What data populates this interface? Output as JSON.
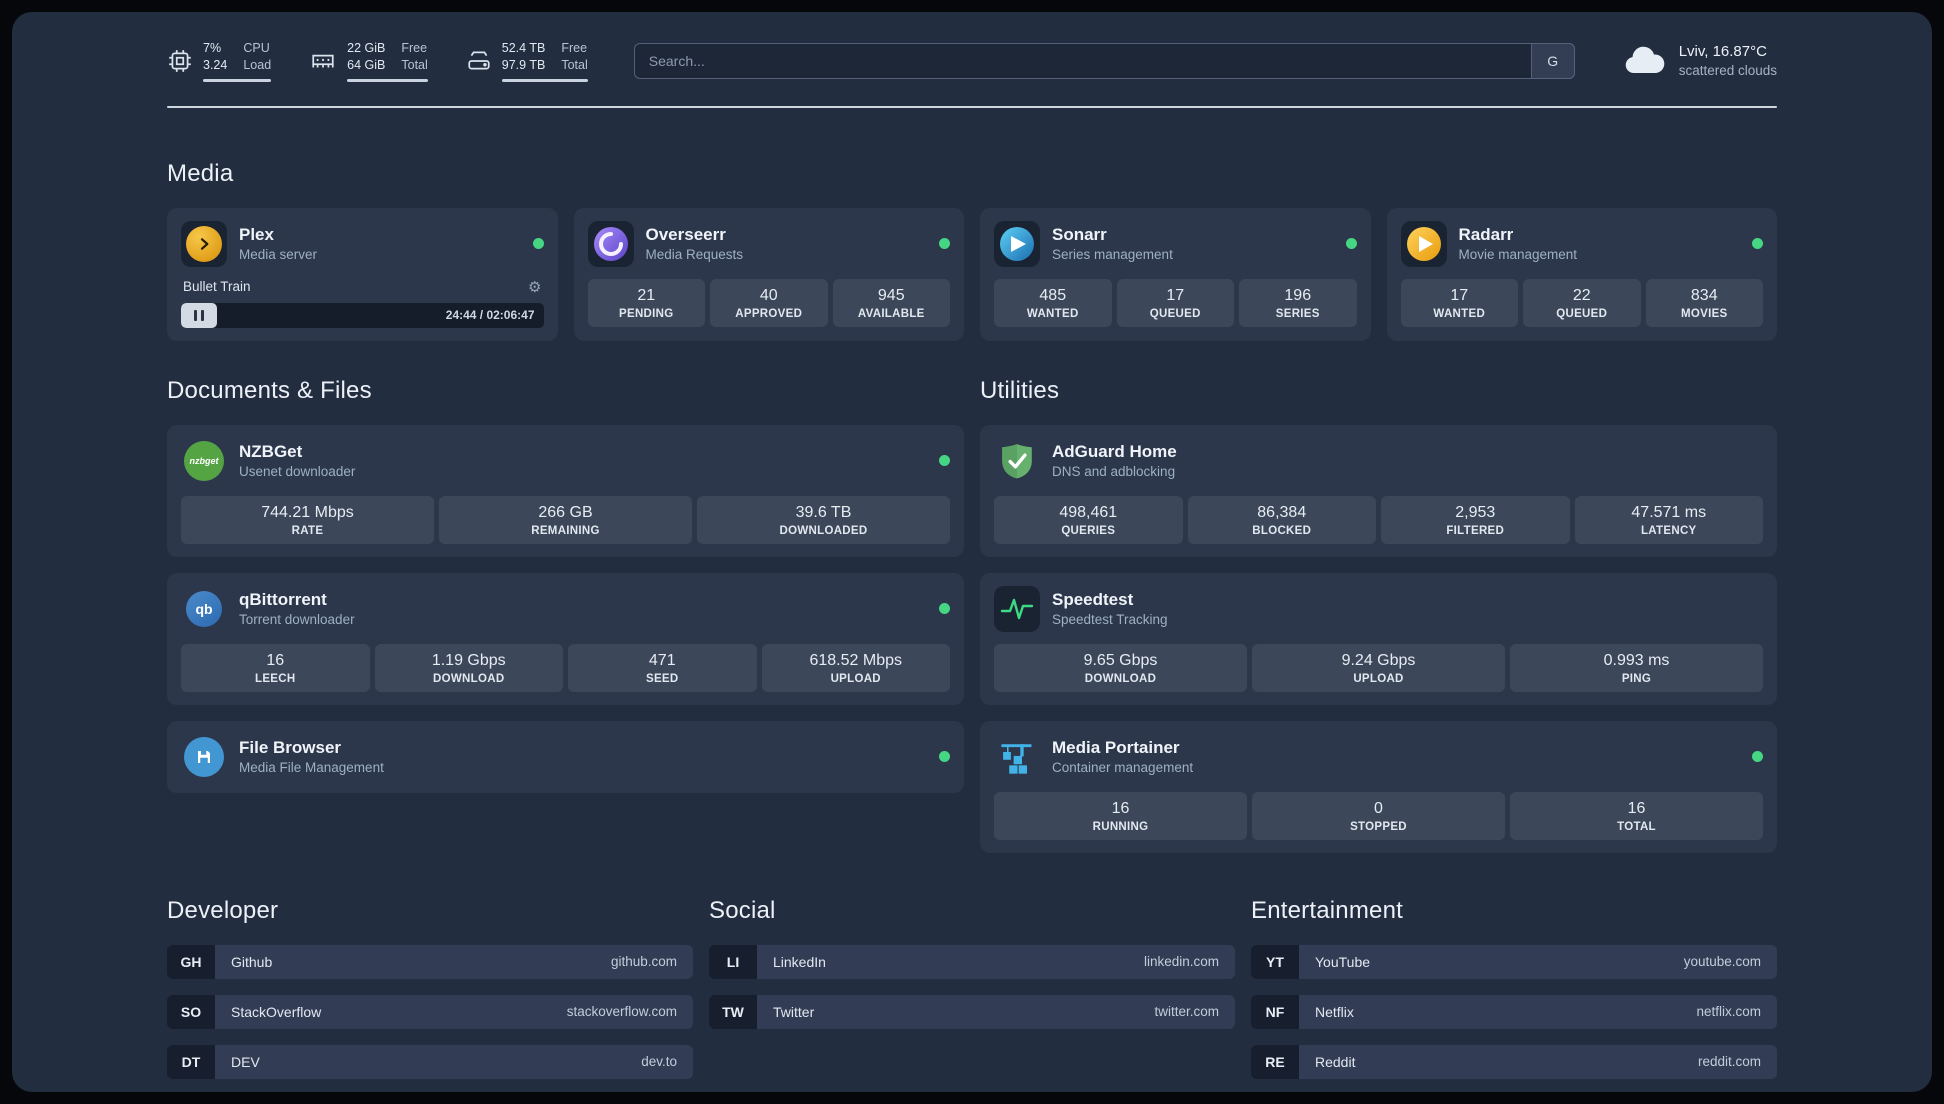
{
  "colors": {
    "status_online": "#46d583",
    "background": "#222d40",
    "card": "#2c374c",
    "tile": "#3c4759",
    "accent_plex": "#e5a00d",
    "accent_overseerr": "#7a5af8",
    "accent_sonarr": "#35c5f4",
    "accent_radarr": "#f5b52e",
    "accent_nzbget": "#55a444",
    "accent_qbittorrent": "#3577c0",
    "accent_filebrowser": "#4296d2",
    "accent_adguard": "#67b16e",
    "accent_speedtest": "#3ddc84",
    "accent_portainer": "#41b3e8"
  },
  "topbar": {
    "resources": [
      {
        "icon": "cpu-icon",
        "value_top": "7%",
        "value_bottom": "3.24",
        "label_top": "CPU",
        "label_bottom": "Load"
      },
      {
        "icon": "ram-icon",
        "value_top": "22 GiB",
        "value_bottom": "64 GiB",
        "label_top": "Free",
        "label_bottom": "Total"
      },
      {
        "icon": "disk-icon",
        "value_top": "52.4 TB",
        "value_bottom": "97.9 TB",
        "label_top": "Free",
        "label_bottom": "Total"
      }
    ],
    "search": {
      "placeholder": "Search...",
      "value": "",
      "button_label": "G"
    },
    "weather": {
      "location": "Lviv, 16.87°C",
      "condition": "scattered clouds"
    }
  },
  "icons": {
    "gear": "⚙",
    "nzbget_logo_text": "nzbget",
    "qbittorrent_logo_text": "qb"
  },
  "sections": {
    "media": {
      "title": "Media",
      "plex": {
        "name": "Plex",
        "desc": "Media server",
        "status": "online",
        "now_playing": "Bullet Train",
        "time": "24:44 / 02:06:47"
      },
      "overseerr": {
        "name": "Overseerr",
        "desc": "Media Requests",
        "status": "online",
        "stats": [
          {
            "value": "21",
            "label": "PENDING"
          },
          {
            "value": "40",
            "label": "APPROVED"
          },
          {
            "value": "945",
            "label": "AVAILABLE"
          }
        ]
      },
      "sonarr": {
        "name": "Sonarr",
        "desc": "Series management",
        "status": "online",
        "stats": [
          {
            "value": "485",
            "label": "WANTED"
          },
          {
            "value": "17",
            "label": "QUEUED"
          },
          {
            "value": "196",
            "label": "SERIES"
          }
        ]
      },
      "radarr": {
        "name": "Radarr",
        "desc": "Movie management",
        "status": "online",
        "stats": [
          {
            "value": "17",
            "label": "WANTED"
          },
          {
            "value": "22",
            "label": "QUEUED"
          },
          {
            "value": "834",
            "label": "MOVIES"
          }
        ]
      }
    },
    "documents": {
      "title": "Documents & Files",
      "nzbget": {
        "name": "NZBGet",
        "desc": "Usenet downloader",
        "status": "online",
        "stats": [
          {
            "value": "744.21 Mbps",
            "label": "RATE"
          },
          {
            "value": "266 GB",
            "label": "REMAINING"
          },
          {
            "value": "39.6 TB",
            "label": "DOWNLOADED"
          }
        ]
      },
      "qbittorrent": {
        "name": "qBittorrent",
        "desc": "Torrent downloader",
        "status": "online",
        "stats": [
          {
            "value": "16",
            "label": "LEECH"
          },
          {
            "value": "1.19 Gbps",
            "label": "DOWNLOAD"
          },
          {
            "value": "471",
            "label": "SEED"
          },
          {
            "value": "618.52 Mbps",
            "label": "UPLOAD"
          }
        ]
      },
      "filebrowser": {
        "name": "File Browser",
        "desc": "Media File Management",
        "status": "online"
      }
    },
    "utilities": {
      "title": "Utilities",
      "adguard": {
        "name": "AdGuard Home",
        "desc": "DNS and adblocking",
        "stats": [
          {
            "value": "498,461",
            "label": "QUERIES"
          },
          {
            "value": "86,384",
            "label": "BLOCKED"
          },
          {
            "value": "2,953",
            "label": "FILTERED"
          },
          {
            "value": "47.571 ms",
            "label": "LATENCY"
          }
        ]
      },
      "speedtest": {
        "name": "Speedtest",
        "desc": "Speedtest Tracking",
        "stats": [
          {
            "value": "9.65 Gbps",
            "label": "DOWNLOAD"
          },
          {
            "value": "9.24 Gbps",
            "label": "UPLOAD"
          },
          {
            "value": "0.993 ms",
            "label": "PING"
          }
        ]
      },
      "portainer": {
        "name": "Media Portainer",
        "desc": "Container management",
        "status": "online",
        "stats": [
          {
            "value": "16",
            "label": "RUNNING"
          },
          {
            "value": "0",
            "label": "STOPPED"
          },
          {
            "value": "16",
            "label": "TOTAL"
          }
        ]
      }
    }
  },
  "bookmarks": {
    "developer": {
      "title": "Developer",
      "items": [
        {
          "abbr": "GH",
          "name": "Github",
          "domain": "github.com"
        },
        {
          "abbr": "SO",
          "name": "StackOverflow",
          "domain": "stackoverflow.com"
        },
        {
          "abbr": "DT",
          "name": "DEV",
          "domain": "dev.to"
        }
      ]
    },
    "social": {
      "title": "Social",
      "items": [
        {
          "abbr": "LI",
          "name": "LinkedIn",
          "domain": "linkedin.com"
        },
        {
          "abbr": "TW",
          "name": "Twitter",
          "domain": "twitter.com"
        }
      ]
    },
    "entertainment": {
      "title": "Entertainment",
      "items": [
        {
          "abbr": "YT",
          "name": "YouTube",
          "domain": "youtube.com"
        },
        {
          "abbr": "NF",
          "name": "Netflix",
          "domain": "netflix.com"
        },
        {
          "abbr": "RE",
          "name": "Reddit",
          "domain": "reddit.com"
        }
      ]
    }
  }
}
